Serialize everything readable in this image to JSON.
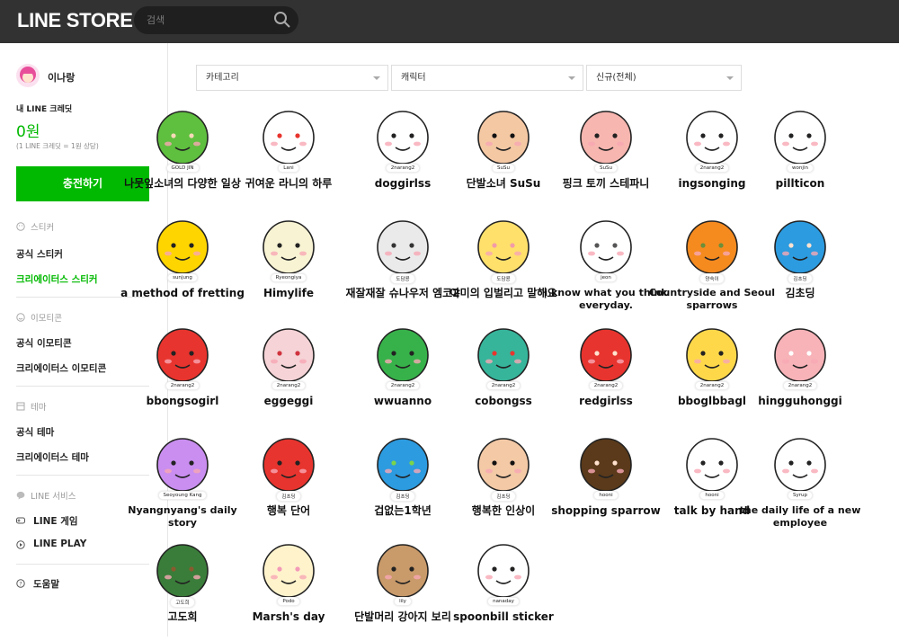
{
  "header": {
    "logo_text": "LINE STORE",
    "search_placeholder": "검색"
  },
  "sidebar": {
    "username": "이나랑",
    "credit_label": "내 LINE 크레딧",
    "credit_value": "0원",
    "credit_note": "(1 LINE 크레딧 = 1원 상당)",
    "charge_button": "충전하기",
    "sticker_header": "스티커",
    "official_sticker": "공식 스티커",
    "creators_sticker": "크리에이터스 스티커",
    "emoticon_header": "이모티콘",
    "official_emoticon": "공식 이모티콘",
    "creators_emoticon": "크리에이터스 이모티콘",
    "theme_header": "테마",
    "official_theme": "공식 테마",
    "creators_theme": "크리에이터스 테마",
    "service_header": "LINE 서비스",
    "line_game": "LINE 게임",
    "line_play": "LINE PLAY",
    "help": "도움말"
  },
  "filters": {
    "category": "카테고리",
    "character": "캐릭터",
    "sort": "신규(전체)"
  },
  "accent": "#00b900",
  "items": [
    {
      "title": "나뭇잎소녀의 다양한 일상",
      "author": "GOLD JIN"
    },
    {
      "title": "귀여운 라니의 하루",
      "author": "Lani"
    },
    {
      "title": "doggirlss",
      "author": "2narang2"
    },
    {
      "title": "단발소녀 SuSu",
      "author": "SuSu"
    },
    {
      "title": "핑크 토끼 스테파니",
      "author": "SuSu"
    },
    {
      "title": "ingsonging",
      "author": "2narang2"
    },
    {
      "title": "pillticon",
      "author": "wonjin"
    },
    {
      "title": "a method of fretting",
      "author": "sunjung"
    },
    {
      "title": "Himylife",
      "author": "Ryeongiya"
    },
    {
      "title": "재잘재잘 슈나우저 엠코2",
      "author": "도담콩"
    },
    {
      "title": "야미의 입벌리고 말해요",
      "author": "도담콩"
    },
    {
      "title": "i know what you think everyday.",
      "author": "jeon"
    },
    {
      "title": "Countryside and Seoul sparrows",
      "author": "양숙이"
    },
    {
      "title": "김초딩",
      "author": "김초딩"
    },
    {
      "title": "bbongsogirl",
      "author": "2narang2"
    },
    {
      "title": "eggeggi",
      "author": "2narang2"
    },
    {
      "title": "wwuanno",
      "author": "2narang2"
    },
    {
      "title": "cobongss",
      "author": "2narang2"
    },
    {
      "title": "redgirlss",
      "author": "2narang2"
    },
    {
      "title": "bboglbbagl",
      "author": "2narang2"
    },
    {
      "title": "hingguhonggi",
      "author": "2narang2"
    },
    {
      "title": "Nyangnyang's daily story",
      "author": "Seoyoung Kang"
    },
    {
      "title": "행복 단어",
      "author": "김초딩"
    },
    {
      "title": "겁없는1학년",
      "author": "김초딩"
    },
    {
      "title": "행복한 인상이",
      "author": "김초딩"
    },
    {
      "title": "shopping sparrow",
      "author": "hooni"
    },
    {
      "title": "talk by hand",
      "author": "hooni"
    },
    {
      "title": "the daily life of a new employee",
      "author": "Syrup"
    },
    {
      "title": "고도희",
      "author": "고도희"
    },
    {
      "title": "Marsh's day",
      "author": "Podo"
    },
    {
      "title": "단발머리 강아지 보리",
      "author": "lily"
    },
    {
      "title": "spoonbill sticker",
      "author": "nanaday"
    }
  ]
}
